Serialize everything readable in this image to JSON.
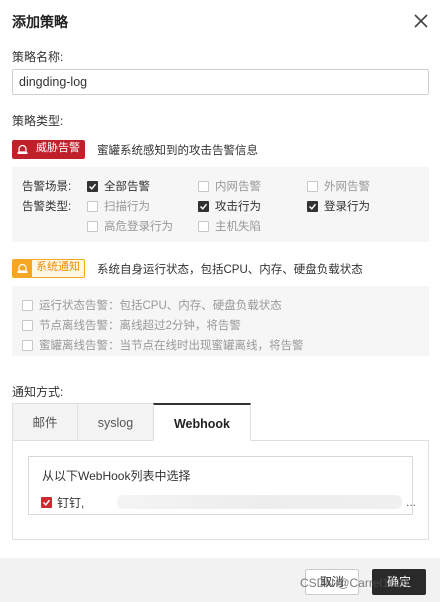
{
  "dialog": {
    "title": "添加策略",
    "policy_name_label": "策略名称:",
    "policy_name_value": "dingding-log",
    "policy_type_label": "策略类型:"
  },
  "threat": {
    "badge": "威胁告警",
    "desc": "蜜罐系统感知到的攻击告警信息",
    "scene_label": "告警场景:",
    "type_label": "告警类型:",
    "scene_options": [
      {
        "label": "全部告警",
        "checked": true,
        "enabled": true
      },
      {
        "label": "内网告警",
        "checked": false,
        "enabled": false
      },
      {
        "label": "外网告警",
        "checked": false,
        "enabled": false
      }
    ],
    "type_options": [
      {
        "label": "扫描行为",
        "checked": false,
        "enabled": false
      },
      {
        "label": "攻击行为",
        "checked": true,
        "enabled": true
      },
      {
        "label": "登录行为",
        "checked": true,
        "enabled": true
      },
      {
        "label": "高危登录行为",
        "checked": false,
        "enabled": false
      },
      {
        "label": "主机失陷",
        "checked": false,
        "enabled": false
      }
    ]
  },
  "system": {
    "badge": "系统通知",
    "desc": "系统自身运行状态，包括CPU、内存、硬盘负载状态",
    "options": [
      {
        "label": "运行状态告警：包括CPU、内存、硬盘负载状态",
        "checked": false
      },
      {
        "label": "节点离线告警：离线超过2分钟，将告警",
        "checked": false
      },
      {
        "label": "蜜罐离线告警：当节点在线时出现蜜罐离线，将告警",
        "checked": false
      }
    ]
  },
  "notify": {
    "label": "通知方式:",
    "tabs": [
      "邮件",
      "syslog",
      "Webhook"
    ],
    "active_tab": "Webhook",
    "webhook_list_title": "从以下WebHook列表中选择",
    "webhook_item_label": "钉钉,",
    "webhook_item_ellipsis": "..."
  },
  "footer": {
    "cancel_label": "取消",
    "ok_label": "确定",
    "watermark": "CSDN @Carrel1024"
  },
  "colors": {
    "threat_red": "#c0202a",
    "system_orange": "#f5a623",
    "checkbox_dark": "#333333",
    "checkbox_red": "#d0282f"
  },
  "icons": {
    "close": "close-icon",
    "threat": "alarm-bell-icon",
    "system": "notice-icon"
  }
}
